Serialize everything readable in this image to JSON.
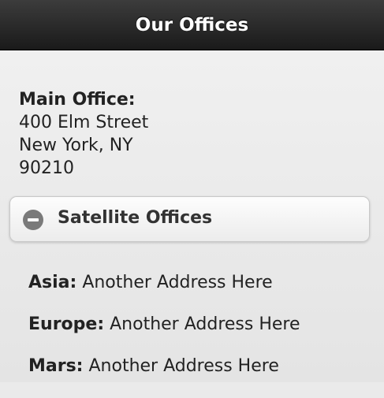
{
  "header": {
    "title": "Our Offices"
  },
  "main_office": {
    "label": "Main Office:",
    "lines": [
      "400 Elm Street",
      "New York, NY",
      "90210"
    ]
  },
  "satellite": {
    "heading": "Satellite Offices",
    "icon": "minus-circle-icon",
    "items": [
      {
        "region": "Asia:",
        "address": "Another Address Here"
      },
      {
        "region": "Europe:",
        "address": "Another Address Here"
      },
      {
        "region": "Mars:",
        "address": "Another Address Here"
      }
    ]
  }
}
